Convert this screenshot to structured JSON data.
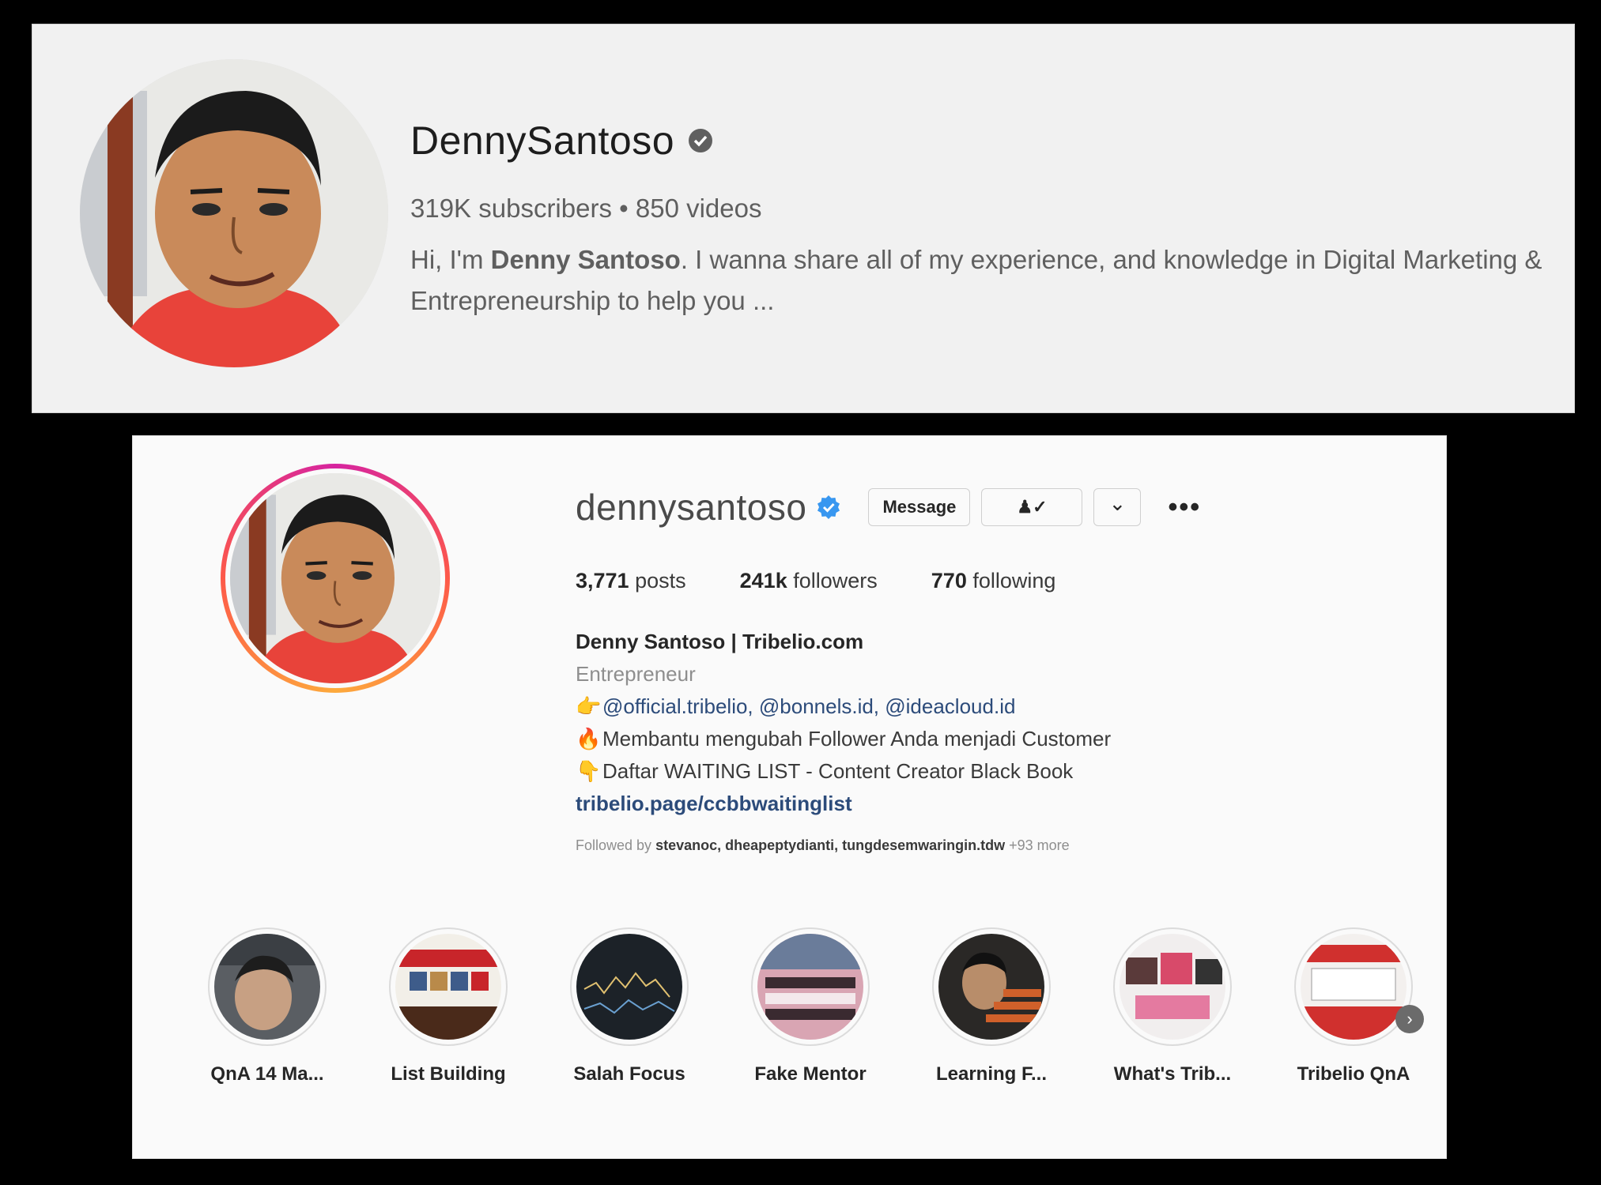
{
  "youtube": {
    "channel_name": "DennySantoso",
    "subscribers": "319K subscribers",
    "separator": "•",
    "videos": "850 videos",
    "desc_prefix": "Hi, I'm ",
    "desc_bold": "Denny Santoso",
    "desc_rest": ". I wanna share all of my experience, and knowledge in Digital Marketing & Entrepreneurship to help you ..."
  },
  "instagram": {
    "username": "dennysantoso",
    "message_button": "Message",
    "follow_icon_text": "♟✓",
    "dropdown_icon": "⌄",
    "more_icon": "•••",
    "posts_count": "3,771",
    "posts_label": "posts",
    "followers_count": "241k",
    "followers_label": "followers",
    "following_count": "770",
    "following_label": "following",
    "full_name": "Denny Santoso | Tribelio.com",
    "category": "Entrepreneur",
    "bio_line1_emoji": "👉",
    "bio_line1_mentions": "@official.tribelio, @bonnels.id, @ideacloud.id",
    "bio_line2_emoji": "🔥",
    "bio_line2": "Membantu mengubah Follower Anda menjadi Customer",
    "bio_line3_emoji": "👇",
    "bio_line3": "Daftar WAITING LIST - Content Creator Black Book",
    "bio_link": "tribelio.page/ccbbwaitinglist",
    "followed_by_prefix": "Followed by ",
    "followed_by_names": "stevanoc, dheapeptydianti, tungdesemwaringin.tdw",
    "followed_by_more": " +93 more",
    "highlights": [
      {
        "label": "QnA 14 Ma..."
      },
      {
        "label": "List Building"
      },
      {
        "label": "Salah Focus"
      },
      {
        "label": "Fake Mentor"
      },
      {
        "label": "Learning F..."
      },
      {
        "label": "What's Trib..."
      },
      {
        "label": "Tribelio QnA"
      }
    ],
    "next_icon": "›"
  },
  "colors": {
    "verified_blue": "#3897f0",
    "ring_gradient": [
      "#d6249f",
      "#fd5949",
      "#fdaa3c"
    ]
  }
}
